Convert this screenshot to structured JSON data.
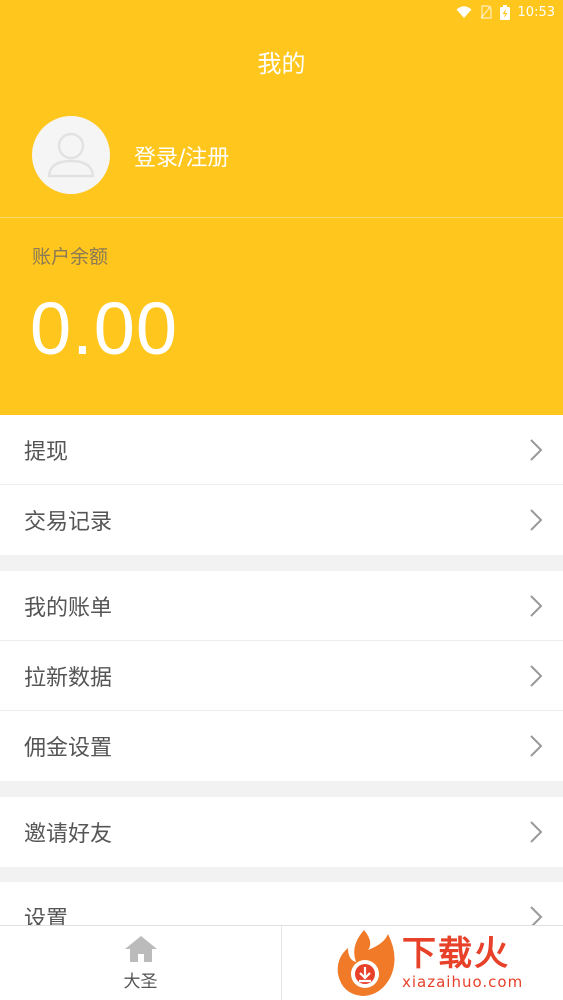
{
  "status_bar": {
    "time": "10:53",
    "icons": [
      "wifi-icon",
      "no-sim-icon",
      "battery-charging-icon"
    ]
  },
  "header": {
    "title": "我的",
    "login_label": "登录/注册",
    "balance_label": "账户余额",
    "balance_value": "0.00"
  },
  "menu": {
    "groups": [
      [
        {
          "label": "提现"
        },
        {
          "label": "交易记录"
        }
      ],
      [
        {
          "label": "我的账单"
        },
        {
          "label": "拉新数据"
        },
        {
          "label": "佣金设置"
        }
      ],
      [
        {
          "label": "邀请好友"
        }
      ],
      [
        {
          "label": "设置"
        }
      ]
    ]
  },
  "tabbar": {
    "items": [
      {
        "label": "大圣",
        "icon": "home-icon"
      }
    ]
  },
  "watermark": {
    "title": "下载火",
    "domain": "xiazaihuo.com"
  },
  "colors": {
    "brand": "#ffc61e",
    "text": "#555555",
    "watermark": "#e8412a"
  }
}
